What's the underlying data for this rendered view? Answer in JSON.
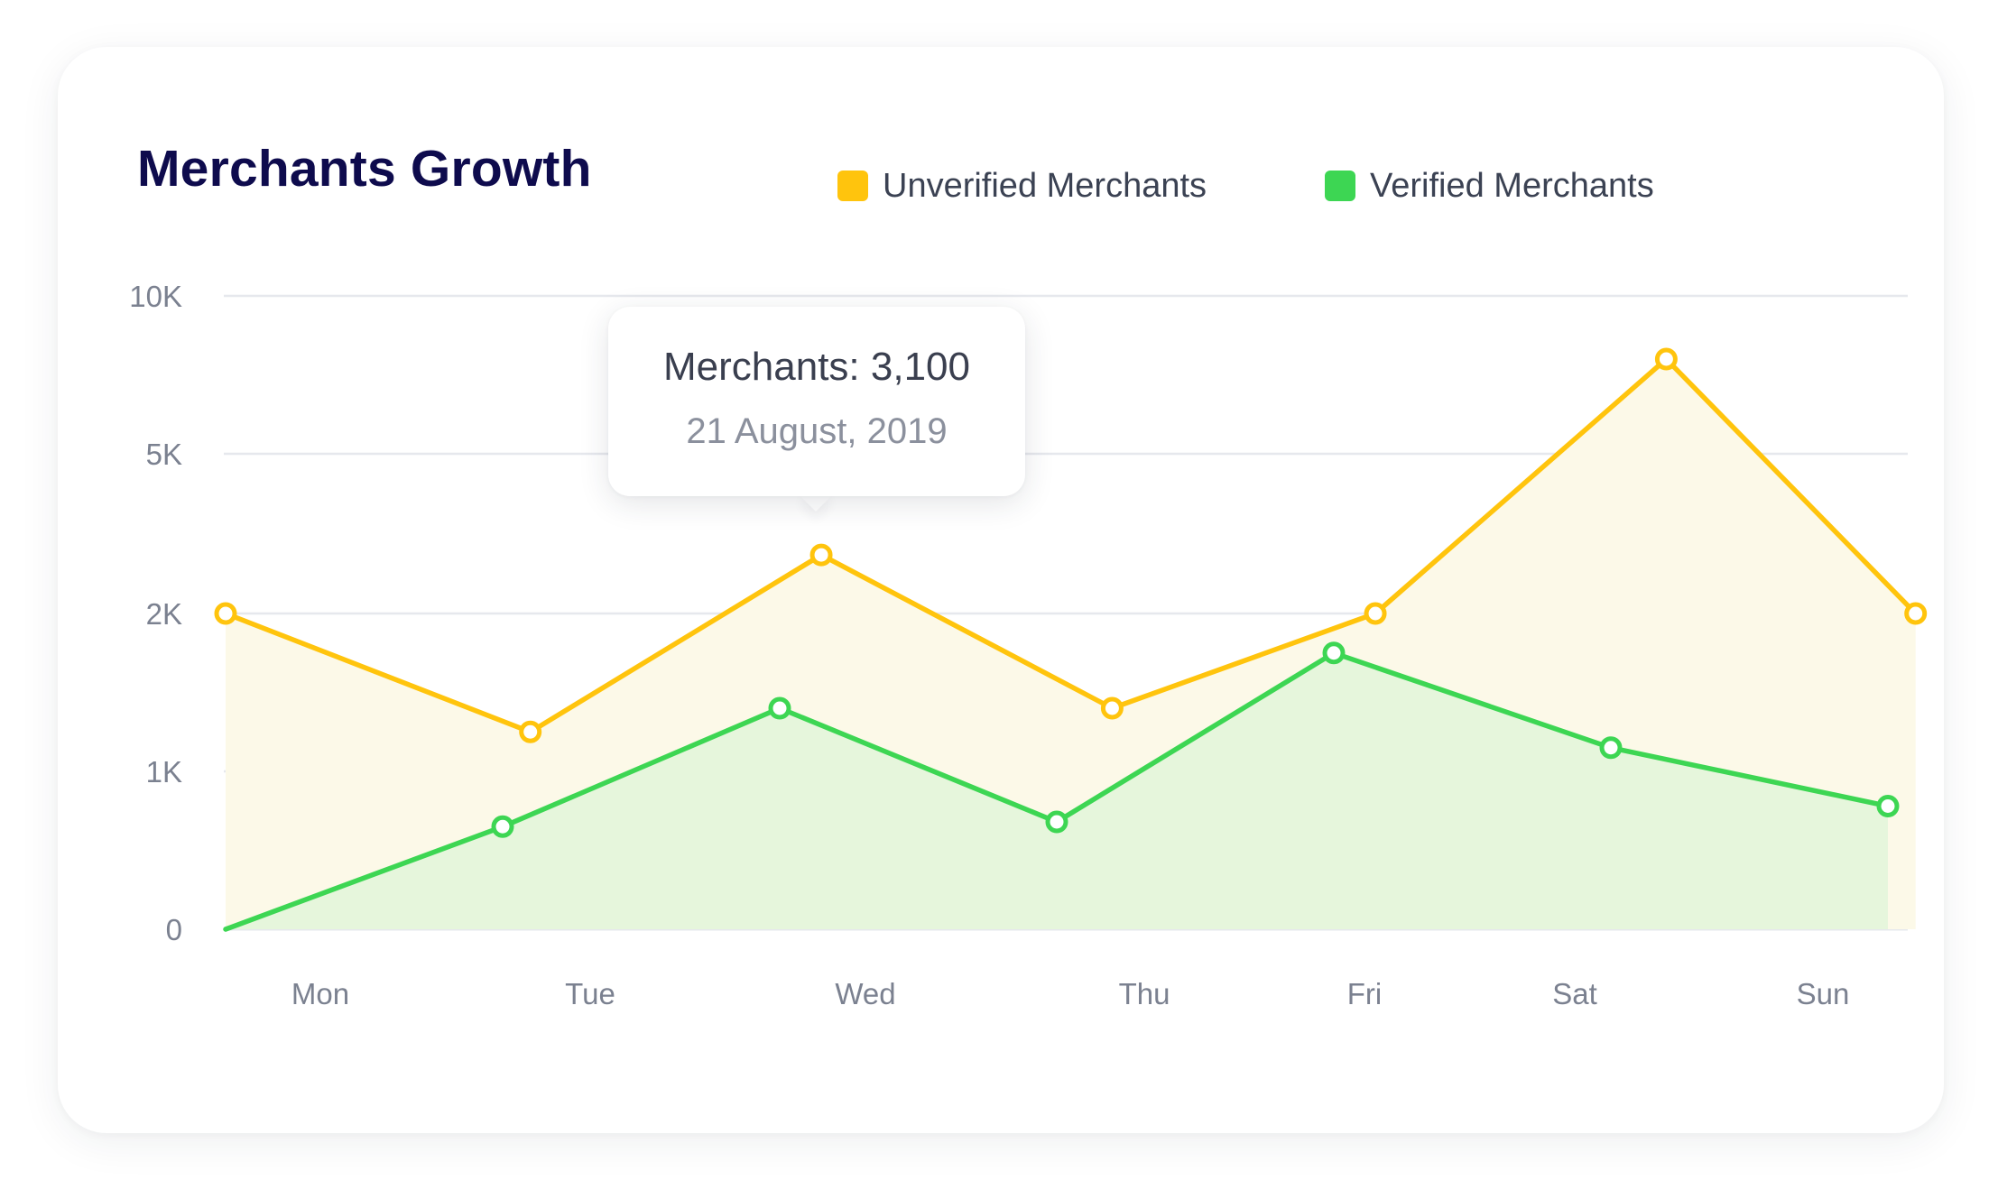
{
  "card": {
    "title": "Merchants Growth"
  },
  "legend": [
    {
      "label": "Unverified Merchants",
      "color": "#ffc40d"
    },
    {
      "label": "Verified Merchants",
      "color": "#3dd653"
    }
  ],
  "tooltip": {
    "title": "Merchants: 3,100",
    "subtitle": "21 August, 2019"
  },
  "colors": {
    "unverified_line": "#ffc40d",
    "unverified_fill": "#fcf9e8",
    "verified_line": "#3dd653",
    "verified_fill": "#e6f6dc",
    "grid": "#e6e8ed"
  },
  "chart_data": {
    "type": "area",
    "title": "Merchants Growth",
    "categories": [
      "Mon",
      "Tue",
      "Wed",
      "Thu",
      "Fri",
      "Sat",
      "Sun"
    ],
    "y_ticks": [
      {
        "label": "0",
        "value": 0
      },
      {
        "label": "1K",
        "value": 1000
      },
      {
        "label": "2K",
        "value": 2000
      },
      {
        "label": "5K",
        "value": 5000
      },
      {
        "label": "10K",
        "value": 10000
      }
    ],
    "series": [
      {
        "name": "Unverified Merchants",
        "color": "#ffc40d",
        "points": [
          {
            "x": 0.0,
            "y": 2000
          },
          {
            "x": 1.1,
            "y": 1250
          },
          {
            "x": 2.15,
            "y": 3100
          },
          {
            "x": 3.2,
            "y": 1400
          },
          {
            "x": 4.15,
            "y": 2000
          },
          {
            "x": 5.2,
            "y": 8000
          },
          {
            "x": 6.1,
            "y": 2000
          }
        ]
      },
      {
        "name": "Verified Merchants",
        "color": "#3dd653",
        "points": [
          {
            "x": 0.0,
            "y": 0
          },
          {
            "x": 1.0,
            "y": 650
          },
          {
            "x": 2.0,
            "y": 1400
          },
          {
            "x": 3.0,
            "y": 680
          },
          {
            "x": 4.0,
            "y": 1750
          },
          {
            "x": 5.0,
            "y": 1150
          },
          {
            "x": 6.0,
            "y": 780
          }
        ]
      }
    ],
    "grid": true,
    "legend_position": "top-right"
  }
}
